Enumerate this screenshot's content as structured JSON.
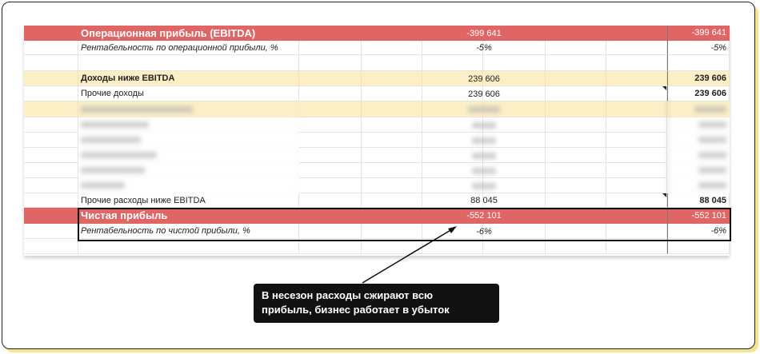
{
  "rows": [
    {
      "label": "Операционная прибыль (EBITDA)",
      "mid": "-399 641",
      "right": "-399 641"
    },
    {
      "label": "Рентабельность по операционной прибыли, %",
      "mid": "-5%",
      "right": "-5%"
    },
    {
      "label": "Доходы ниже EBITDA",
      "mid": "239 606",
      "right": "239 606"
    },
    {
      "label": "Прочие доходы",
      "mid": "239 606",
      "right": "239 606"
    },
    {
      "label": "Прочие расходы ниже EBITDA",
      "mid": "88 045",
      "right": "88 045"
    },
    {
      "label": "Чистая прибыль",
      "mid": "-552 101",
      "right": "-552 101"
    },
    {
      "label": "Рентабельность по чистой прибыли, %",
      "mid": "-6%",
      "right": "-6%"
    }
  ],
  "callout": {
    "line1": "В несезон расходы сжирают всю",
    "line2": "прибыль, бизнес работает в убыток"
  },
  "colors": {
    "red": "#e06666",
    "yellow": "#fcefc6",
    "callout_bg": "#111111",
    "outer_shadow": "#f6e58d"
  }
}
